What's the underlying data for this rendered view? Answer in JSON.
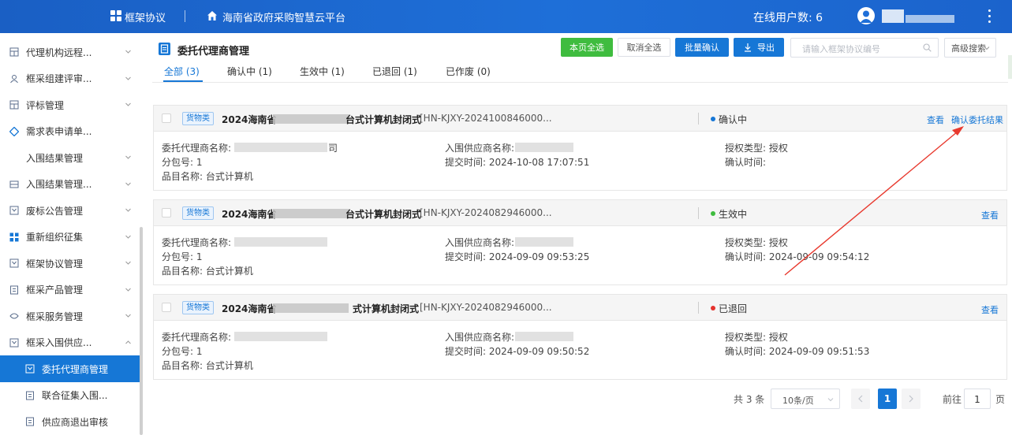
{
  "topbar": {
    "app_name": "框架协议",
    "platform": "海南省政府采购智慧云平台",
    "online_users": "在线用户数: 6"
  },
  "sidebar": {
    "items": [
      {
        "label": "代理机构远程...",
        "icon": "grid-doc-icon",
        "chevron": "down"
      },
      {
        "label": "框采组建评审...",
        "icon": "people-icon",
        "chevron": "down"
      },
      {
        "label": "评标管理",
        "icon": "grid-doc-icon",
        "chevron": "down"
      },
      {
        "label": "需求表申请单...",
        "icon": "diamond-icon",
        "chevron": ""
      },
      {
        "label": "入围结果管理",
        "icon": "",
        "chevron": "down"
      },
      {
        "label": "入围结果管理...",
        "icon": "table-icon",
        "chevron": "down"
      },
      {
        "label": "废标公告管理",
        "icon": "frame-icon",
        "chevron": "down"
      },
      {
        "label": "重新组织征集",
        "icon": "squares-icon",
        "chevron": "down"
      },
      {
        "label": "框架协议管理",
        "icon": "frame-icon",
        "chevron": "down"
      },
      {
        "label": "框采产品管理",
        "icon": "doc-icon",
        "chevron": "down"
      },
      {
        "label": "框采服务管理",
        "icon": "service-icon",
        "chevron": "down"
      },
      {
        "label": "框采入围供应...",
        "icon": "frame-icon",
        "chevron": "up"
      },
      {
        "label": "委托代理商管理",
        "icon": "frame-icon",
        "chevron": "",
        "active": true
      },
      {
        "label": "联合征集入围...",
        "icon": "doc-icon",
        "chevron": ""
      },
      {
        "label": "供应商退出审核",
        "icon": "doc-icon",
        "chevron": ""
      }
    ]
  },
  "header": {
    "title": "委托代理商管理",
    "btn_select_page": "本页全选",
    "btn_cancel_select": "取消全选",
    "btn_batch_confirm": "批量确认",
    "btn_export": "导出",
    "search_placeholder": "请输入框架协议编号",
    "advanced_search": "高级搜索"
  },
  "tabs": [
    {
      "label": "全部 (3)",
      "active": true
    },
    {
      "label": "确认中 (1)"
    },
    {
      "label": "生效中 (1)"
    },
    {
      "label": "已退回 (1)"
    },
    {
      "label": "已作废 (0)"
    }
  ],
  "field_labels": {
    "agent": "委托代理商名称:",
    "package": "分包号:",
    "item": "品目名称:",
    "supplier": "入围供应商名称:",
    "submit": "提交时间:",
    "auth": "授权类型:",
    "confirm": "确认时间:"
  },
  "records": [
    {
      "tag": "货物类",
      "title_prefix": "2024海南省",
      "title_suffix": "台式计算机封闭式",
      "code": "[HN-KJXY-2024100846000...",
      "status": "确认中",
      "status_color": "#1677d6",
      "action_view": "查看",
      "action_confirm": "确认委托结果",
      "agent_tail": "司",
      "package": "1",
      "item": "台式计算机",
      "submit_time": "2024-10-08 17:07:51",
      "auth_type": "授权",
      "confirm_time": ""
    },
    {
      "tag": "货物类",
      "title_prefix": "2024海南省",
      "title_suffix": "台式计算机封闭式",
      "code": "[HN-KJXY-2024082946000...",
      "status": "生效中",
      "status_color": "#3fbc3f",
      "action_view": "查看",
      "action_confirm": "",
      "agent_tail": "",
      "package": "1",
      "item": "台式计算机",
      "submit_time": "2024-09-09 09:53:25",
      "auth_type": "授权",
      "confirm_time": "2024-09-09 09:54:12"
    },
    {
      "tag": "货物类",
      "title_prefix": "2024海南省",
      "title_suffix": "式计算机封闭式",
      "code": "[HN-KJXY-2024082946000...",
      "status": "已退回",
      "status_color": "#e5322d",
      "action_view": "查看",
      "action_confirm": "",
      "agent_tail": "",
      "package": "1",
      "item": "台式计算机",
      "submit_time": "2024-09-09 09:50:52",
      "auth_type": "授权",
      "confirm_time": "2024-09-09 09:51:53"
    }
  ],
  "pagination": {
    "total": "共 3 条",
    "page_size": "10条/页",
    "current_page": "1",
    "goto_label": "前往",
    "goto_value": "1",
    "page_unit": "页"
  },
  "colors": {
    "primary": "#1677d6",
    "topbar": "#1e6fd8",
    "green_button": "#3fbc3f",
    "annotation_arrow": "#e8392e"
  }
}
